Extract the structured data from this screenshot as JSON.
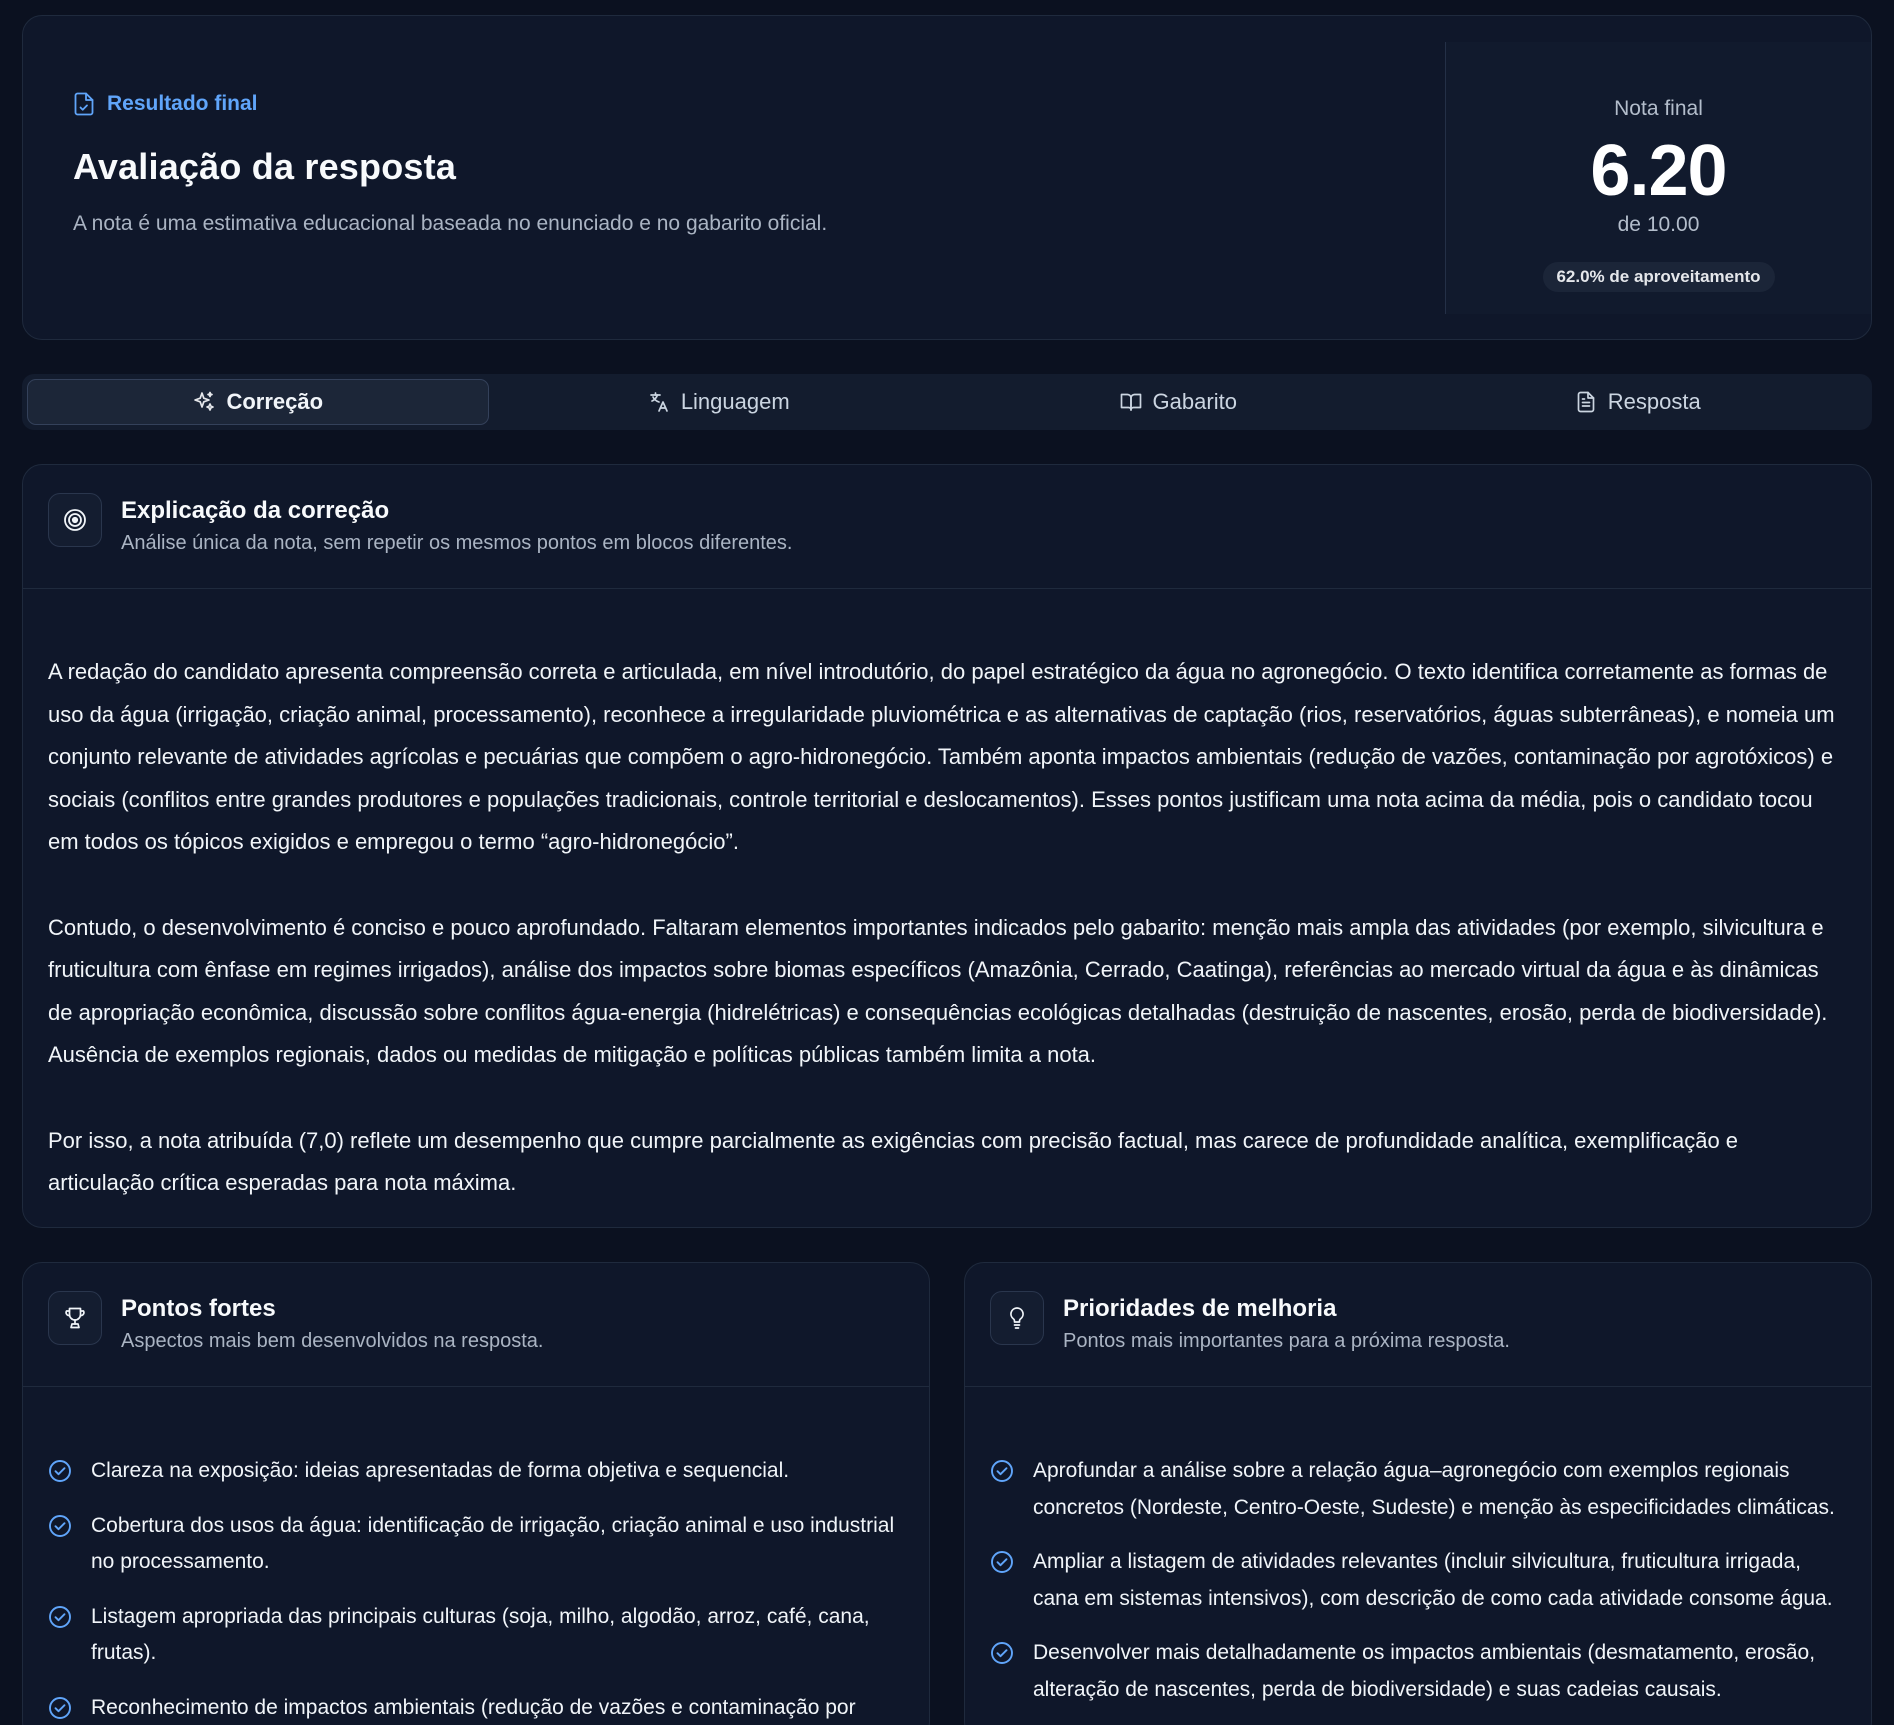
{
  "header": {
    "eyebrow": "Resultado final",
    "title": "Avaliação da resposta",
    "subtitle": "A nota é uma estimativa educacional baseada no enunciado e no gabarito oficial."
  },
  "score": {
    "label": "Nota final",
    "value": "6.20",
    "max": "de 10.00",
    "badge": "62.0% de aproveitamento"
  },
  "tabs": [
    {
      "label": "Correção",
      "icon": "sparkles-icon",
      "active": true
    },
    {
      "label": "Linguagem",
      "icon": "translate-icon",
      "active": false
    },
    {
      "label": "Gabarito",
      "icon": "book-open-icon",
      "active": false
    },
    {
      "label": "Resposta",
      "icon": "document-text-icon",
      "active": false
    }
  ],
  "explanation": {
    "icon": "target-icon",
    "title": "Explicação da correção",
    "subtitle": "Análise única da nota, sem repetir os mesmos pontos em blocos diferentes.",
    "paragraphs": [
      "A redação do candidato apresenta compreensão correta e articulada, em nível introdutório, do papel estratégico da água no agronegócio. O texto identifica corretamente as formas de uso da água (irrigação, criação animal, processamento), reconhece a irregularidade pluviométrica e as alternativas de captação (rios, reservatórios, águas subterrâneas), e nomeia um conjunto relevante de atividades agrícolas e pecuárias que compõem o agro-hidronegócio. Também aponta impactos ambientais (redução de vazões, contaminação por agrotóxicos) e sociais (conflitos entre grandes produtores e populações tradicionais, controle territorial e deslocamentos). Esses pontos justificam uma nota acima da média, pois o candidato tocou em todos os tópicos exigidos e empregou o termo “agro-hidronegócio”.",
      "Contudo, o desenvolvimento é conciso e pouco aprofundado. Faltaram elementos importantes indicados pelo gabarito: menção mais ampla das atividades (por exemplo, silvicultura e fruticultura com ênfase em regimes irrigados), análise dos impactos sobre biomas específicos (Amazônia, Cerrado, Caatinga), referências ao mercado virtual da água e às dinâmicas de apropriação econômica, discussão sobre conflitos água-energia (hidrelétricas) e consequências ecológicas detalhadas (destruição de nascentes, erosão, perda de biodiversidade). Ausência de exemplos regionais, dados ou medidas de mitigação e políticas públicas também limita a nota.",
      "Por isso, a nota atribuída (7,0) reflete um desempenho que cumpre parcialmente as exigências com precisão factual, mas carece de profundidade analítica, exemplificação e articulação crítica esperadas para nota máxima."
    ]
  },
  "strengths": {
    "icon": "trophy-icon",
    "title": "Pontos fortes",
    "subtitle": "Aspectos mais bem desenvolvidos na resposta.",
    "items": [
      "Clareza na exposição: ideias apresentadas de forma objetiva e sequencial.",
      "Cobertura dos usos da água: identificação de irrigação, criação animal e uso industrial no processamento.",
      "Listagem apropriada das principais culturas (soja, milho, algodão, arroz, café, cana, frutas).",
      "Reconhecimento de impactos ambientais (redução de vazões e contaminação por"
    ]
  },
  "improvements": {
    "icon": "lightbulb-icon",
    "title": "Prioridades de melhoria",
    "subtitle": "Pontos mais importantes para a próxima resposta.",
    "items": [
      "Aprofundar a análise sobre a relação água–agronegócio com exemplos regionais concretos (Nordeste, Centro-Oeste, Sudeste) e menção às especificidades climáticas.",
      "Ampliar a listagem de atividades relevantes (incluir silvicultura, fruticultura irrigada, cana em sistemas intensivos), com descrição de como cada atividade consome água.",
      "Desenvolver mais detalhadamente os impactos ambientais (desmatamento, erosão, alteração de nascentes, perda de biodiversidade) e suas cadeias causais."
    ]
  },
  "colors": {
    "background": "#0b1120",
    "card": "#0f172a",
    "accent": "#60a5fa",
    "border": "#1f2a3d"
  }
}
